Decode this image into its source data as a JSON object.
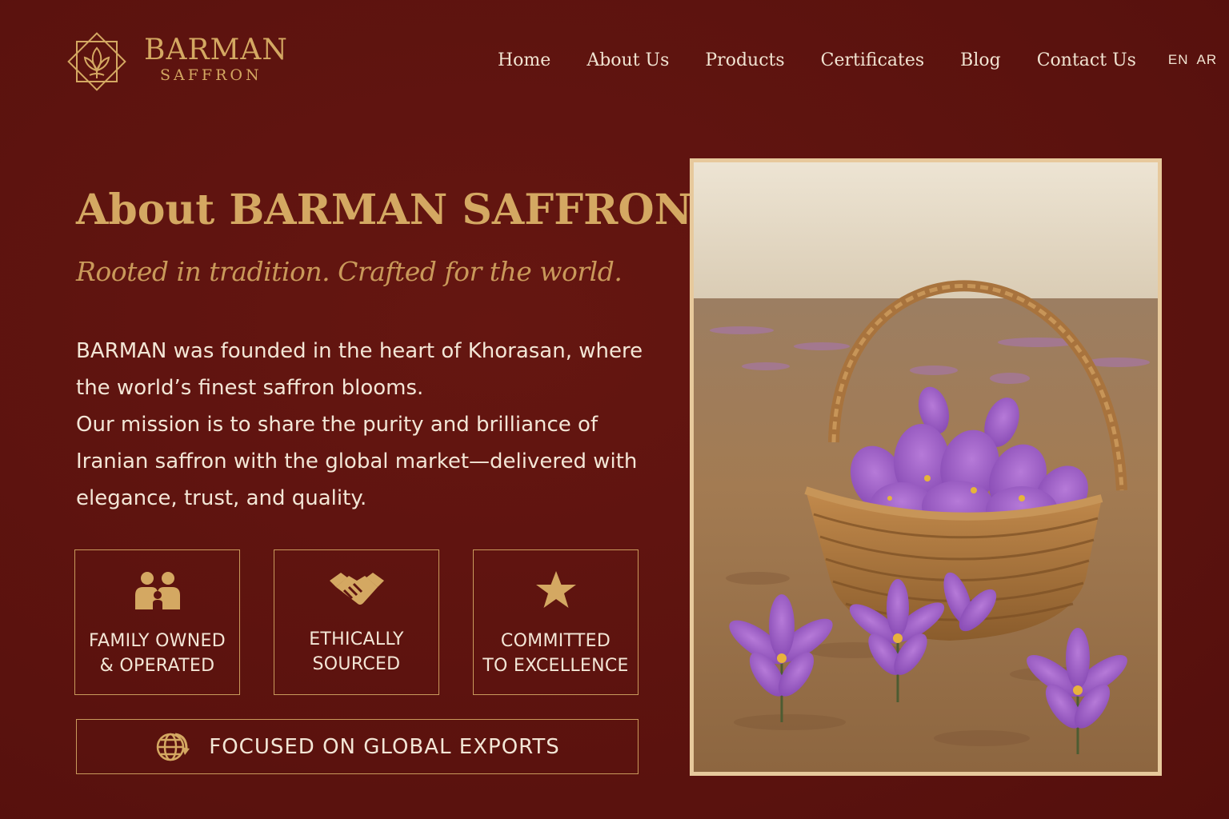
{
  "brand": {
    "name": "BARMAN",
    "sub": "SAFFRON"
  },
  "nav": {
    "items": [
      "Home",
      "About Us",
      "Products",
      "Certificates",
      "Blog",
      "Contact Us"
    ],
    "lang_en": "EN",
    "lang_ar": "AR"
  },
  "about": {
    "title": "About BARMAN SAFFRON",
    "tagline": "Rooted in tradition. Crafted for the world.",
    "lines": [
      "BARMAN was founded in the heart of Khorasan, where",
      "the world’s finest saffron blooms.",
      "Our mission is to share the purity  and brilliance of",
      "Iranian saffron with the global market—delivered with",
      "elegance, trust, and quality."
    ]
  },
  "features": [
    {
      "label": "Family owned\n& operated",
      "icon": "family-icon"
    },
    {
      "label": "Ethically\nsourced",
      "icon": "handshake-icon"
    },
    {
      "label": "Committed\nto excellence",
      "icon": "star-icon"
    }
  ],
  "export": {
    "label": "Focused on global exports",
    "icon": "globe-icon"
  },
  "colors": {
    "background": "#5e1410",
    "gold": "#d4a862",
    "text": "#f3e6d6",
    "border": "#c99a5c"
  }
}
